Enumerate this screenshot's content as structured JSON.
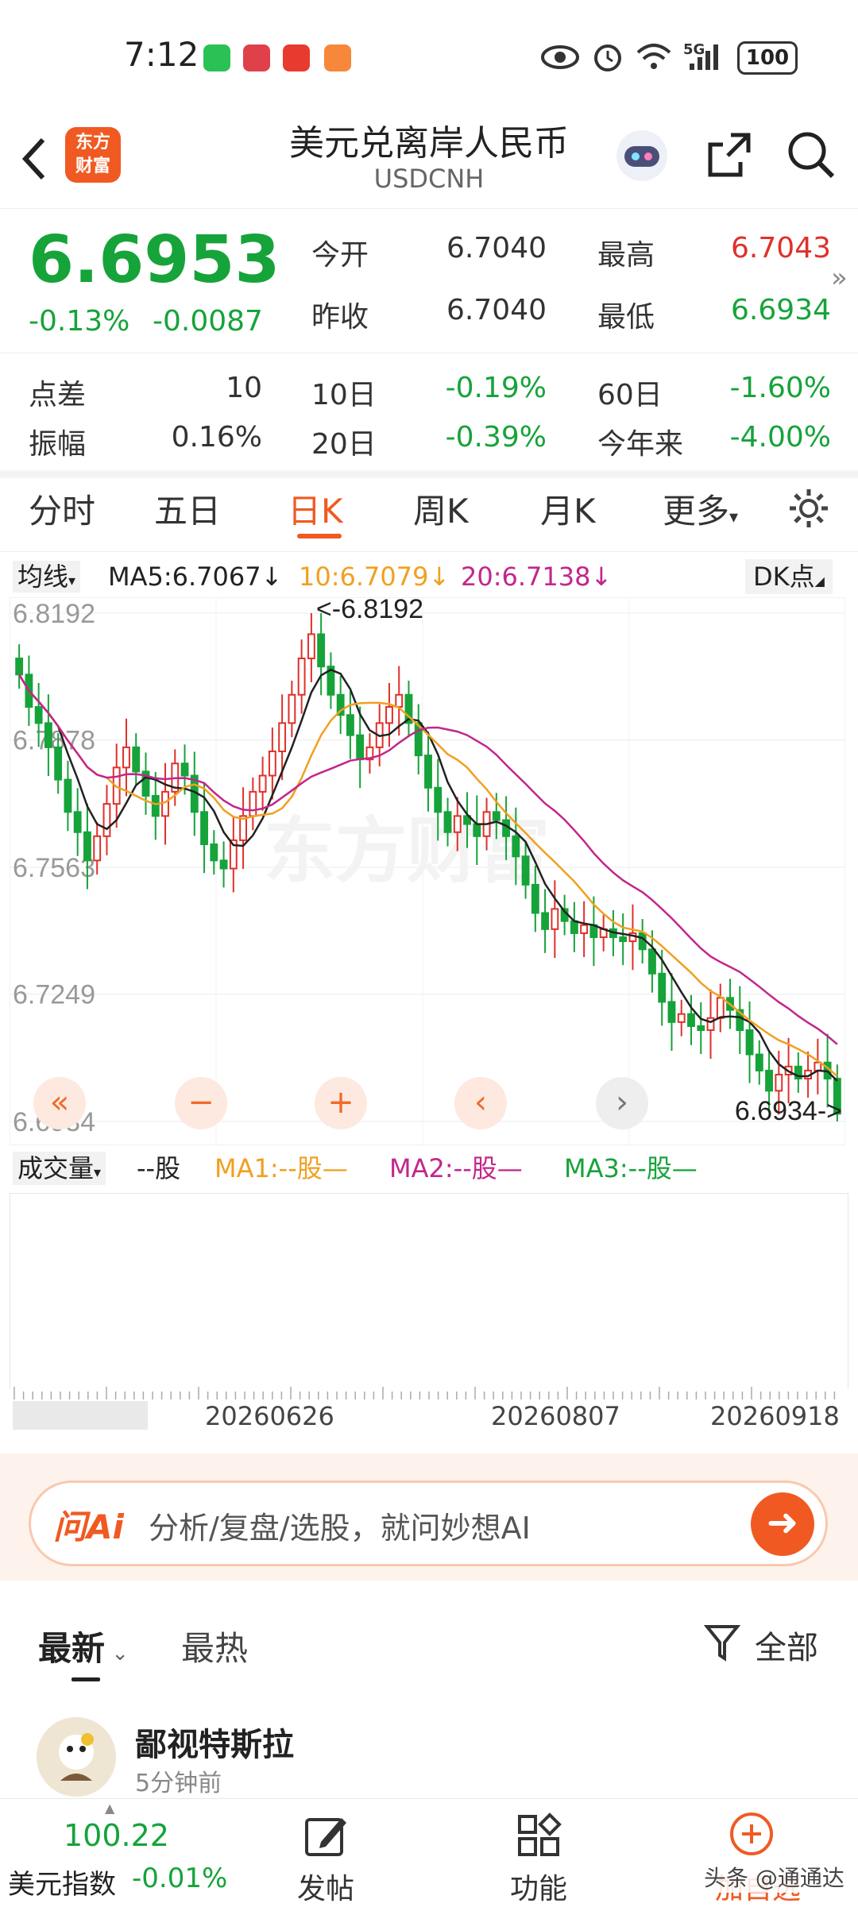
{
  "status_bar": {
    "time": "7:12",
    "battery": "100",
    "signal": "5G"
  },
  "header": {
    "title": "美元兑离岸人民币",
    "code": "USDCNH",
    "logo_text_1": "东方",
    "logo_text_2": "财富"
  },
  "quote": {
    "price": "6.6953",
    "change_pct": "-0.13%",
    "change": "-0.0087",
    "open_label": "今开",
    "open": "6.7040",
    "prev_close_label": "昨收",
    "prev_close": "6.7040",
    "high_label": "最高",
    "high": "6.7043",
    "low_label": "最低",
    "low": "6.6934",
    "spread_label": "点差",
    "spread": "10",
    "amplitude_label": "振幅",
    "amplitude": "0.16%",
    "d10_label": "10日",
    "d10": "-0.19%",
    "d20_label": "20日",
    "d20": "-0.39%",
    "d60_label": "60日",
    "d60": "-1.60%",
    "ytd_label": "今年来",
    "ytd": "-4.00%"
  },
  "tabs": [
    "分时",
    "五日",
    "日K",
    "周K",
    "月K",
    "更多"
  ],
  "active_tab": "日K",
  "ma_bar": {
    "selector": "均线",
    "ma5": "MA5:6.7067↓",
    "ma10": "10:6.7079↓",
    "ma20": "20:6.7138↓",
    "dk": "DK点"
  },
  "chart_data": {
    "type": "candlestick",
    "y_ticks": [
      "6.8192",
      "6.7878",
      "6.7563",
      "6.7249",
      "6.6934"
    ],
    "ylim": [
      6.6934,
      6.8192
    ],
    "max_annotation": "<-6.8192",
    "min_annotation": "6.6934->",
    "x_ticks": [
      "20260626",
      "20260807",
      "20260918"
    ],
    "colors": {
      "up": "#e0302a",
      "down": "#16a33a",
      "ma5": "#222222",
      "ma10": "#f0a020",
      "ma20": "#c2268c"
    },
    "closes": [
      6.804,
      6.796,
      6.792,
      6.786,
      6.778,
      6.77,
      6.765,
      6.758,
      6.764,
      6.772,
      6.781,
      6.786,
      6.78,
      6.774,
      6.769,
      6.775,
      6.782,
      6.779,
      6.77,
      6.762,
      6.758,
      6.756,
      6.763,
      6.769,
      6.775,
      6.779,
      6.785,
      6.792,
      6.799,
      6.808,
      6.814,
      6.806,
      6.799,
      6.794,
      6.789,
      6.783,
      6.786,
      6.792,
      6.796,
      6.799,
      6.792,
      6.784,
      6.776,
      6.77,
      6.765,
      6.769,
      6.767,
      6.764,
      6.77,
      6.768,
      6.764,
      6.759,
      6.752,
      6.745,
      6.741,
      6.746,
      6.743,
      6.74,
      6.742,
      6.739,
      6.741,
      6.739,
      6.738,
      6.74,
      6.736,
      6.73,
      6.723,
      6.718,
      6.72,
      6.717,
      6.716,
      6.719,
      6.724,
      6.721,
      6.716,
      6.71,
      6.706,
      6.701,
      6.705,
      6.707,
      6.704,
      6.706,
      6.708,
      6.704,
      6.6953
    ]
  },
  "volume": {
    "selector": "成交量",
    "unit": "--股",
    "ma1": "MA1:--股—",
    "ma2": "MA2:--股—",
    "ma3": "MA3:--股—"
  },
  "ai": {
    "badge": "问Ai",
    "placeholder": "分析/复盘/选股，就问妙想AI"
  },
  "feed": {
    "tab_latest": "最新",
    "tab_hot": "最热",
    "filter": "全部",
    "post_author": "鄙视特斯拉",
    "post_time": "5分钟前"
  },
  "bottom_nav": {
    "index_value": "100.22",
    "index_name": "美元指数",
    "index_change": "-0.01%",
    "post": "发帖",
    "function": "功能",
    "watch": "加自选",
    "watermark": "头条 @通通达"
  }
}
